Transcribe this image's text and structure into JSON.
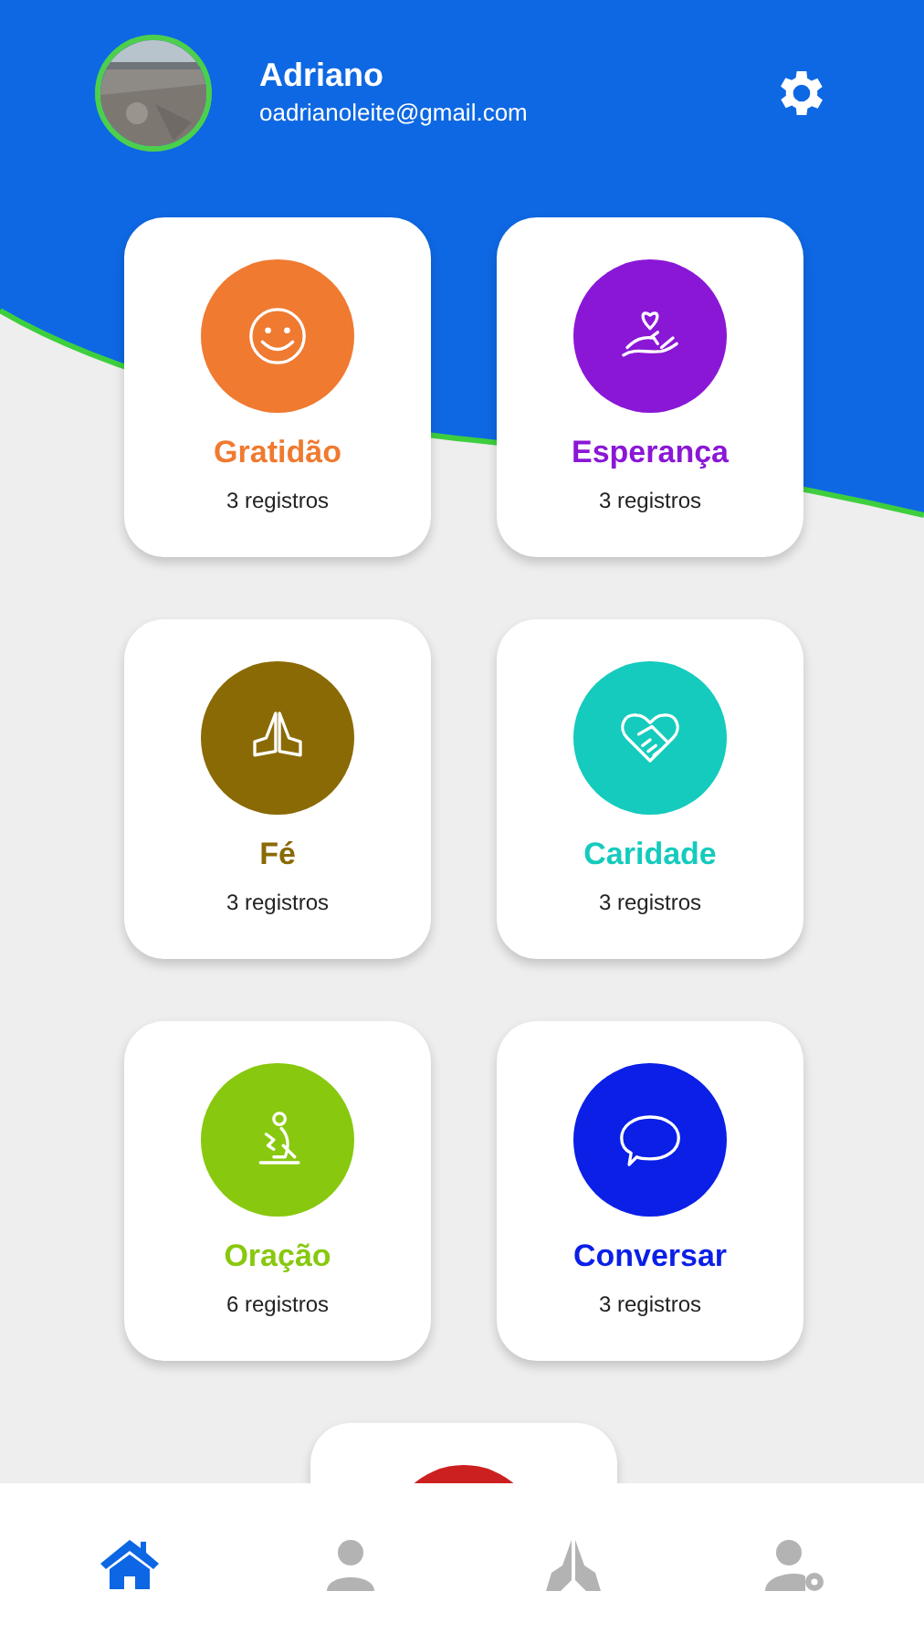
{
  "profile": {
    "kind": "picture",
    "name": "Adriano",
    "email": "oadrianoleite@gmail.com"
  },
  "categories": [
    {
      "title": "Gratidão",
      "count": "3 registros",
      "color": "#ef7a30"
    },
    {
      "title": "Esperança",
      "count": "3 registros",
      "color": "#8a17d6"
    },
    {
      "title": "Fé",
      "count": "3 registros",
      "color": "#8a6a05"
    },
    {
      "title": "Caridade",
      "count": "3 registros",
      "color": "#14cbbd"
    },
    {
      "title": "Oração",
      "count": "6 registros",
      "color": "#88c80e"
    },
    {
      "title": "Conversar",
      "count": "3 registros",
      "color": "#0b1fe6"
    },
    {
      "color": "#cc2020"
    }
  ],
  "nav": [
    {
      "selected": true
    },
    {
      "selected": false
    },
    {
      "selected": false
    },
    {
      "selected": false
    }
  ]
}
